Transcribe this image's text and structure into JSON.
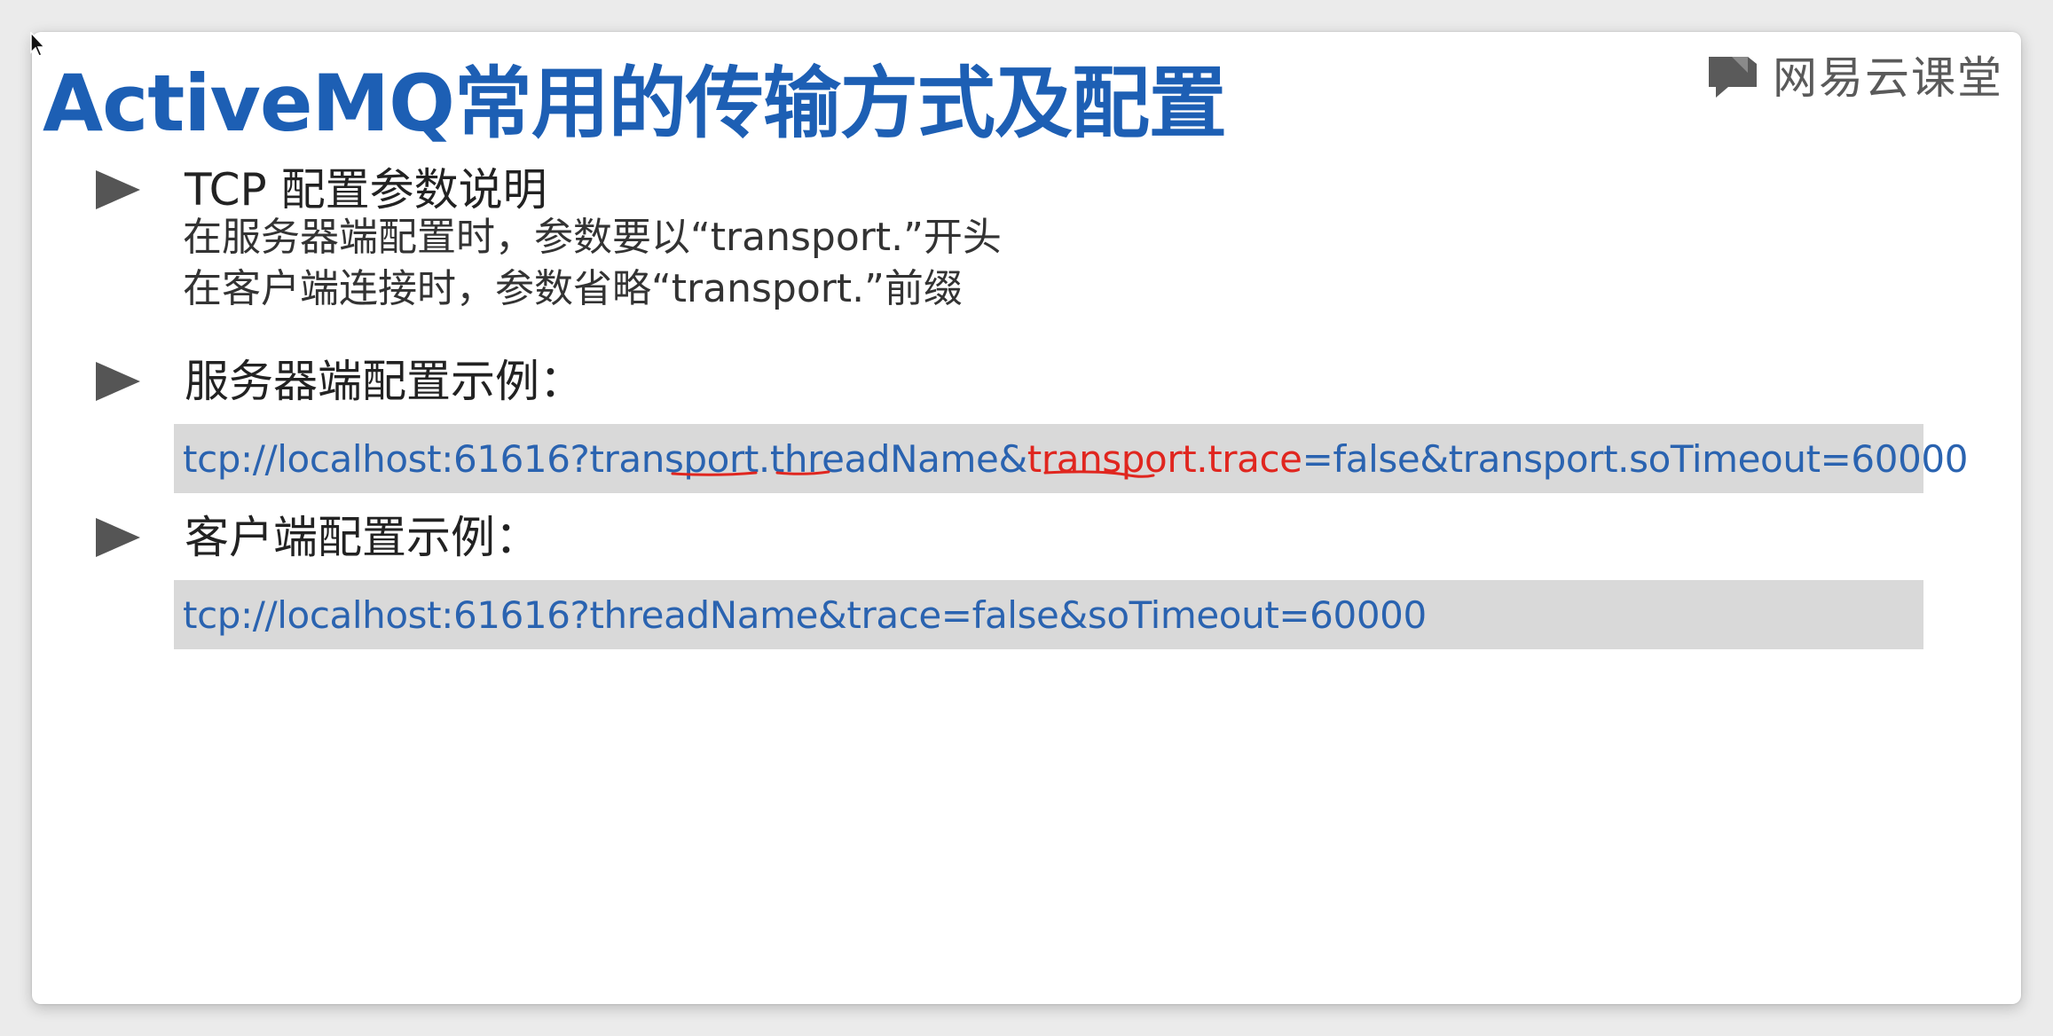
{
  "slide": {
    "title": "ActiveMQ常用的传输方式及配置",
    "brand": "网易云课堂",
    "brand_icon": "chat-bubble-icon",
    "accent_color": "#1d5fb4",
    "annotation_color": "#e0261f"
  },
  "section_tcp": {
    "heading": "TCP 配置参数说明",
    "notes": [
      "在服务器端配置时，参数要以“transport.”开头",
      "在客户端连接时，参数省略“transport.”前缀"
    ]
  },
  "section_server": {
    "heading": "服务器端配置示例：",
    "url_parts": [
      "tcp://localhost:61616?transport.threadName&",
      "transport.trace",
      "=false&transport.soTimeout=60000"
    ]
  },
  "section_client": {
    "heading": "客户端配置示例：",
    "url": "tcp://localhost:61616?threadName&trace=false&soTimeout=60000"
  }
}
